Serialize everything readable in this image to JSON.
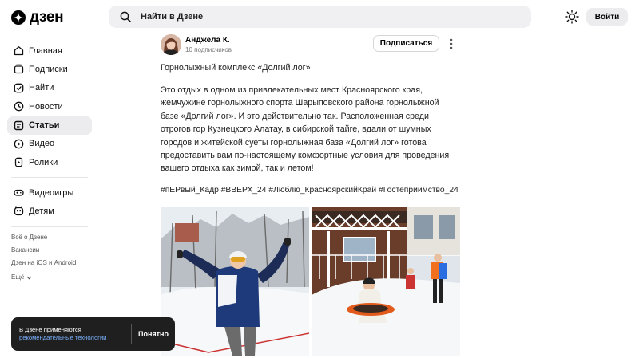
{
  "header": {
    "logo_text": "дзен",
    "search_placeholder": "Найти в Дзене",
    "login_label": "Войти"
  },
  "sidebar": {
    "items": [
      {
        "label": "Главная",
        "icon": "home-icon",
        "active": false
      },
      {
        "label": "Подписки",
        "icon": "subscriptions-icon",
        "active": false
      },
      {
        "label": "Найти",
        "icon": "search-icon",
        "active": false
      },
      {
        "label": "Новости",
        "icon": "news-icon",
        "active": false
      },
      {
        "label": "Статьи",
        "icon": "articles-icon",
        "active": true
      },
      {
        "label": "Видео",
        "icon": "video-icon",
        "active": false
      },
      {
        "label": "Ролики",
        "icon": "clips-icon",
        "active": false
      },
      {
        "label": "Видеоигры",
        "icon": "gamepad-icon",
        "active": false
      },
      {
        "label": "Детям",
        "icon": "kids-icon",
        "active": false
      }
    ],
    "links": [
      "Всё о Дзене",
      "Вакансии",
      "Дзен на iOS и Android"
    ],
    "more_label": "Ещё"
  },
  "post": {
    "author_name": "Анджела К.",
    "author_subscribers": "10 подписчиков",
    "subscribe_label": "Подписаться",
    "title": "Горнолыжный комплекс «Долгий лог»",
    "body": "Это отдых в одном из привлекательных мест Красноярского края, жемчужине горнолыжного спорта Шарыповского района горнолыжной базе «Долгий лог». И это действительно так. Расположенная среди отрогов гор Кузнецкого Алатау, в сибирской тайге, вдали от шумных городов и житейской суеты горнолыжная база «Долгий лог» готова предоставить вам по-настоящему комфортные условия для проведения вашего отдыха как зимой, так и летом!",
    "hashtags": "#пЕРвый_Кадр #ВВЕРХ_24 #Люблю_КрасноярскийКрай #Гостеприимство_24"
  },
  "toast": {
    "text": "В Дзене применяются",
    "link": "рекомендательные технологии",
    "button": "Понятно"
  },
  "colors": {
    "accent_link": "#7ab1ff",
    "active_nav_bg": "#ececef",
    "search_bg": "#f0f0f3"
  }
}
